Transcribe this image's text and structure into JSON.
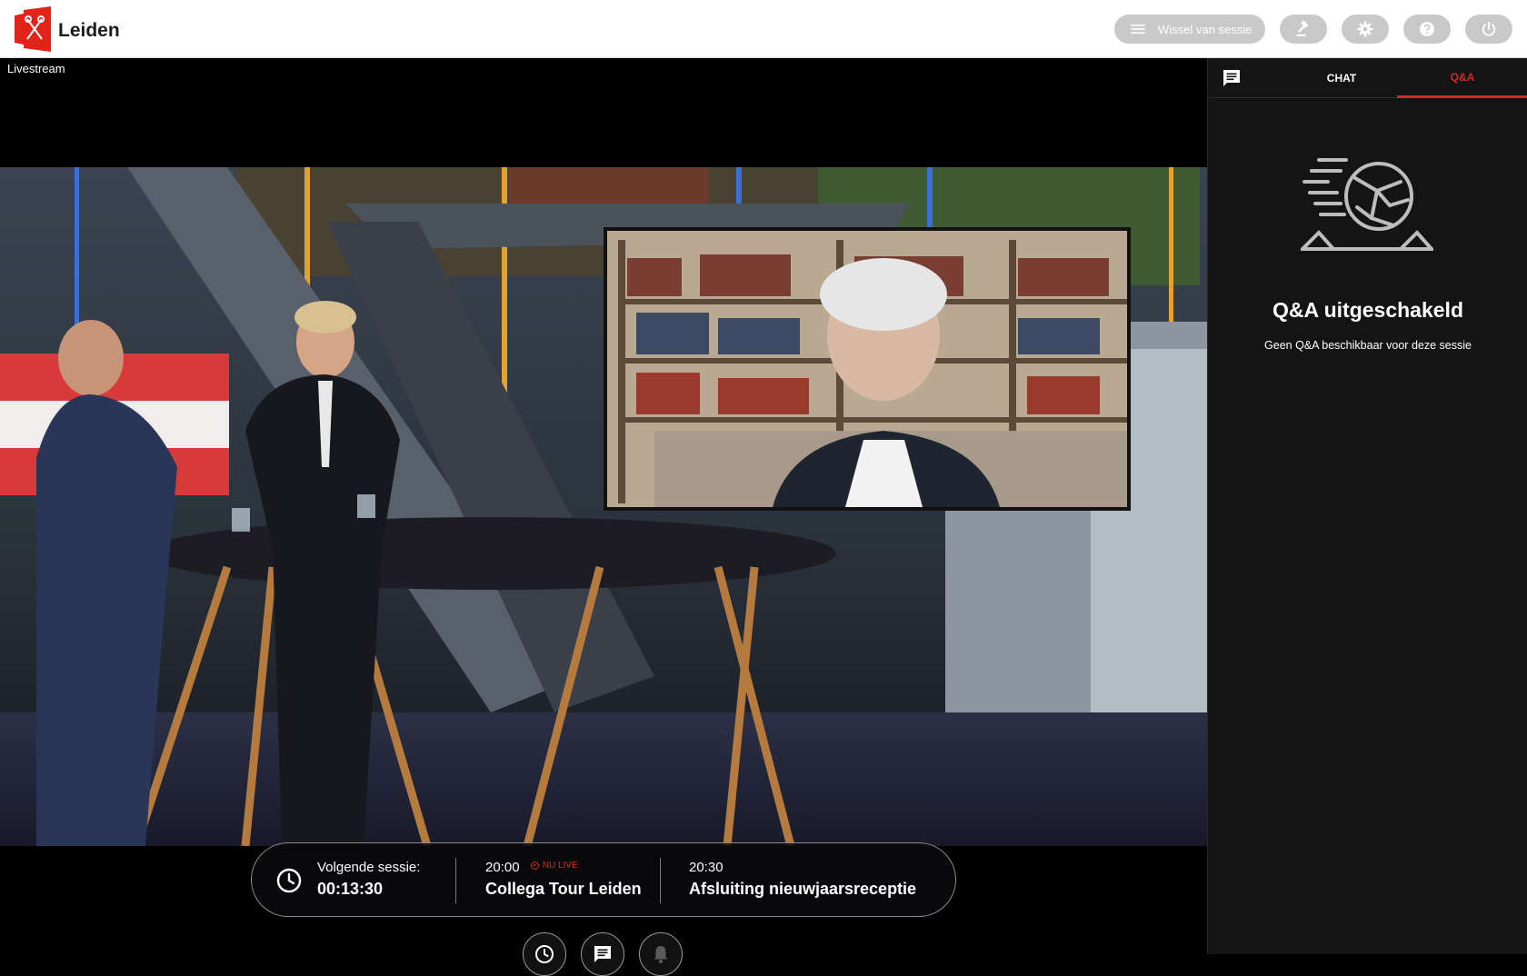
{
  "header": {
    "brand": "Leiden",
    "session_button_label": "Wissel van sessie",
    "icons": [
      "menu-icon",
      "gavel-icon",
      "gear-icon",
      "help-icon",
      "power-icon"
    ]
  },
  "stage": {
    "label": "Livestream"
  },
  "schedule": {
    "next": {
      "label": "Volgende sessie:",
      "countdown": "00:13:30"
    },
    "current": {
      "time": "20:00",
      "live_label": "NU LIVE",
      "title": "Collega Tour Leiden"
    },
    "upcoming": {
      "time": "20:30",
      "title": "Afsluiting nieuwjaarsreceptie"
    }
  },
  "controls": [
    "clock-icon",
    "chat-icon",
    "bell-icon"
  ],
  "panel": {
    "tabs": [
      {
        "label": "CHAT",
        "active": false
      },
      {
        "label": "Q&A",
        "active": true
      }
    ],
    "qa_title": "Q&A uitgeschakeld",
    "qa_subtitle": "Geen Q&A beschikbaar voor deze sessie"
  },
  "colors": {
    "accent": "#d32a2a",
    "header_bg": "#ffffff",
    "button_bg": "#c9c9c9",
    "panel_bg": "#141414"
  }
}
